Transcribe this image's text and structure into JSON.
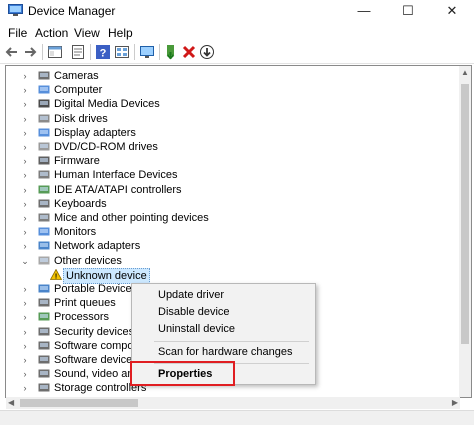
{
  "window": {
    "title": "Device Manager",
    "minimize": "—",
    "maximize": "☐",
    "close": "✕"
  },
  "menu": [
    "File",
    "Action",
    "View",
    "Help"
  ],
  "toolbar": {
    "icons": [
      "back-icon",
      "forward-icon",
      "show-hide-tree-icon",
      "properties-icon",
      "help-icon",
      "view-icon",
      "monitor-icon",
      "update-driver-icon",
      "uninstall-icon",
      "download-icon"
    ]
  },
  "tree": {
    "items": [
      {
        "label": "Cameras",
        "expanded": false
      },
      {
        "label": "Computer",
        "expanded": false
      },
      {
        "label": "Digital Media Devices",
        "expanded": false
      },
      {
        "label": "Disk drives",
        "expanded": false
      },
      {
        "label": "Display adapters",
        "expanded": false
      },
      {
        "label": "DVD/CD-ROM drives",
        "expanded": false
      },
      {
        "label": "Firmware",
        "expanded": false
      },
      {
        "label": "Human Interface Devices",
        "expanded": false
      },
      {
        "label": "IDE ATA/ATAPI controllers",
        "expanded": false
      },
      {
        "label": "Keyboards",
        "expanded": false
      },
      {
        "label": "Mice and other pointing devices",
        "expanded": false
      },
      {
        "label": "Monitors",
        "expanded": false
      },
      {
        "label": "Network adapters",
        "expanded": false
      },
      {
        "label": "Other devices",
        "expanded": true
      },
      {
        "label": "Unknown device",
        "child": true,
        "selected": true
      },
      {
        "label": "Portable Devices",
        "expanded": false
      },
      {
        "label": "Print queues",
        "expanded": false
      },
      {
        "label": "Processors",
        "expanded": false
      },
      {
        "label": "Security devices",
        "expanded": false
      },
      {
        "label": "Software compon",
        "expanded": false
      },
      {
        "label": "Software devices",
        "expanded": false
      },
      {
        "label": "Sound, video and",
        "expanded": false
      },
      {
        "label": "Storage controllers",
        "expanded": false
      }
    ]
  },
  "context_menu": {
    "update_driver": "Update driver",
    "disable_device": "Disable device",
    "uninstall_device": "Uninstall device",
    "scan_hardware": "Scan for hardware changes",
    "properties": "Properties"
  },
  "colors": {
    "highlight_box": "#e01e22",
    "selection": "#cce8ff",
    "warning": "#f2c200"
  }
}
